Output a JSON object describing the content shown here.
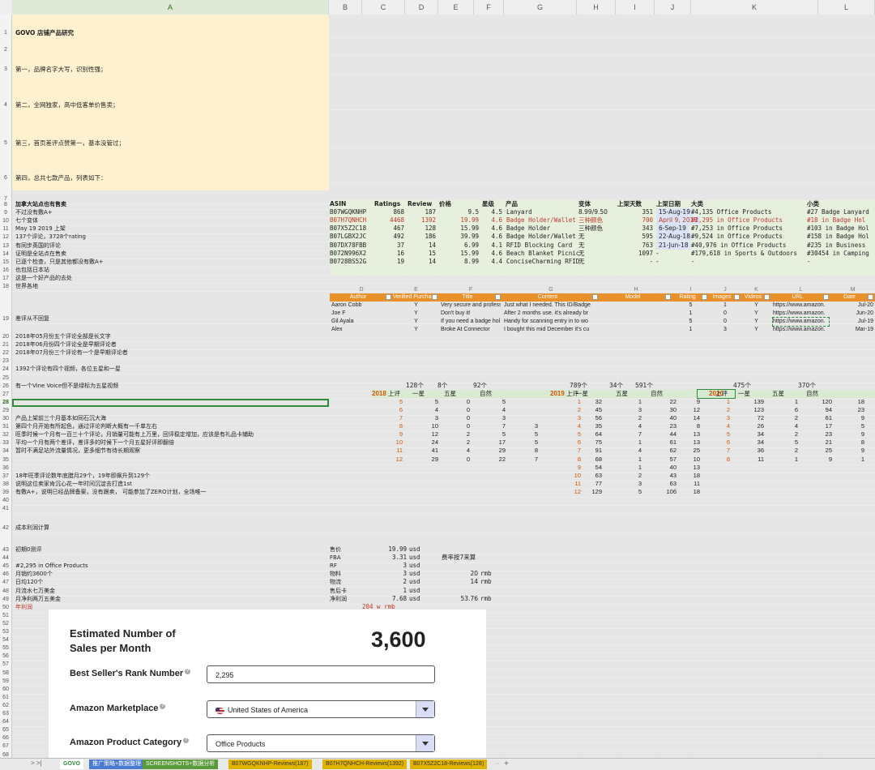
{
  "colors": {
    "note_bg": "#fdf1cf",
    "table_bg": "#e6f0dd",
    "filter_header": "#e8902a",
    "green_sel": "#2e8b3a",
    "red_text": "#c0392b",
    "orange_text": "#d35400",
    "year_bg": "#d9ead3"
  },
  "column_headers": [
    "A",
    "B",
    "C",
    "D",
    "E",
    "F",
    "G",
    "H",
    "I",
    "J",
    "K",
    "L"
  ],
  "notes": {
    "r1": "GOVO 店铺产品研究",
    "r3": "第一，品牌名字大写，识别性强；",
    "r4": "第二，全网独家，高中低客单价售卖；",
    "r5": "第三，首页差评点赞第一，基本没管过；",
    "r6": "第四，总共七款产品，列表如下："
  },
  "left_notes": [
    {
      "row": "8",
      "text": "加拿大站点也有售卖",
      "bold": true
    },
    {
      "row": "9",
      "text": "不过没有敷A+"
    },
    {
      "row": "10",
      "text": "七个变体"
    },
    {
      "row": "11",
      "text": "May 19 2019 上架"
    },
    {
      "row": "12",
      "text": "137个评论，3728个rating"
    },
    {
      "row": "13",
      "text": "有同步英国的评论"
    },
    {
      "row": "14",
      "text": "证明是全站点在售卖"
    },
    {
      "row": "15",
      "text": "已逐个检查，只是其他都没有敷A+"
    },
    {
      "row": "16",
      "text": "也包括日本站"
    },
    {
      "row": "17",
      "text": "这是一个好产品的去处"
    },
    {
      "row": "18",
      "text": "世界各地"
    },
    {
      "row": "19",
      "text": "差评从不回复"
    },
    {
      "row": "20",
      "text": "2018年05月份五个评论全部是长文字"
    },
    {
      "row": "21",
      "text": "2018年06月份四个评论全是早期评论者"
    },
    {
      "row": "22",
      "text": "2018年07月份三个评论有一个是早期评论者"
    },
    {
      "row": "24",
      "text": "1392个评论有四个视频，各位五星和一星"
    },
    {
      "row": "26",
      "text": "有一个Vine Voice但不是绿标为五星视频"
    },
    {
      "row": "30",
      "text": "产品上架前三个月基本如同石沉大海"
    },
    {
      "row": "31",
      "text": "第四个月开始有所起色，通过评论判断大概有一千单左右"
    },
    {
      "row": "32",
      "text": "旺季时候一个月有一百三十个评论，月销量可能有上万里，回评稳定增加，应该是有礼品卡辅助"
    },
    {
      "row": "33",
      "text": "平均一个月有两个差评，差评多的时候下一个月五星好评即翻倍"
    },
    {
      "row": "34",
      "text": "暂时不满足站外流量情况，更多细节有待长期观察"
    },
    {
      "row": "37",
      "text": "18年旺季评论数年底腊月29个，19年即飙升到129个"
    },
    {
      "row": "38",
      "text": "说明这位卖家肯沉心花一年时间沉淀去打造1st"
    },
    {
      "row": "39",
      "text": "有敷A+，说明已经品牌备案，没有跟卖， 可能参加了ZERO计划，全场唯一"
    },
    {
      "row": "42",
      "text": "成本利润计算"
    },
    {
      "row": "43",
      "text": "初期0测评"
    },
    {
      "row": "45",
      "text": "#2,295 in  Office Products"
    },
    {
      "row": "46",
      "text": "月销约3600个"
    },
    {
      "row": "47",
      "text": "日均120个"
    },
    {
      "row": "48",
      "text": "月流水七万美金"
    },
    {
      "row": "49",
      "text": "月净利两万五美金"
    },
    {
      "row": "50",
      "text": "年利润",
      "red": true
    }
  ],
  "product_table": {
    "headers": [
      "ASIN",
      "Ratings",
      "Review",
      "价格",
      "星级",
      "产品",
      "变体",
      "上架天数",
      "上架日期",
      "大类",
      "小类"
    ],
    "rows": [
      [
        "B07WGQKNHP",
        "868",
        "187",
        "9.5",
        "4.5",
        "Lanyard",
        "8.99/9.50",
        "351",
        "15-Aug-19",
        "#4,135 Office Products",
        "#27 Badge Lanyard"
      ],
      [
        "B07H7QNHCH",
        "4468",
        "1392",
        "19.99",
        "4.6",
        "Badge Holder/Wallet",
        "三种颜色",
        "700",
        "April 9, 2018",
        "#2,295 in  Office Products",
        "#18 in  Badge Hol"
      ],
      [
        "B07X5Z2C18",
        "467",
        "128",
        "15.99",
        "4.6",
        "Badge Holder",
        "三种颜色",
        "343",
        "6-Sep-19",
        "#7,253 in Office Products",
        "#103 in Badge Hol"
      ],
      [
        "B07LGBX2JC",
        "492",
        "186",
        "39.99",
        "4.6",
        "Badge Holder/Wallet",
        "无",
        "595",
        "22-Aug-18",
        "#9,524 in Office Products",
        "#158 in Badge Hol"
      ],
      [
        "B07DX78FBB",
        "37",
        "14",
        "6.99",
        "4.1",
        "RFID Blocking Card",
        "无",
        "763",
        "21-Jun-18",
        "#40,976 in Office Products",
        "#235 in Business"
      ],
      [
        "B072N996X2",
        "16",
        "15",
        "15.99",
        "4.6",
        "Beach Blanket Picnic",
        "无",
        "1097",
        "-",
        "#179,618 in Sports & Outdoors",
        "#30454 in Camping"
      ],
      [
        "B0728BS52G",
        "19",
        "14",
        "8.99",
        "4.4",
        "ConciseCharming RFID",
        "无",
        "-",
        "-",
        "-",
        "-"
      ]
    ]
  },
  "review_table": {
    "col_letters": [
      "D",
      "E",
      "F",
      "G",
      "H",
      "I",
      "J",
      "K",
      "L",
      "M"
    ],
    "headers": [
      "Author",
      "Verified Purchase",
      "Title",
      "Content",
      "Model",
      "Rating",
      "Images",
      "Videos",
      "URL",
      "Date"
    ],
    "rows": [
      [
        "Aaron Cobb",
        "Y",
        "Very secure and profess",
        "Just what I needed. This ID/Badge",
        "",
        "5",
        "1",
        "Y",
        "https://www.amazon.",
        "Jul-20"
      ],
      [
        "Joe F",
        "Y",
        "Don't buy it!",
        "After 2 months use. it's already br",
        "",
        "1",
        "0",
        "Y",
        "https://www.amazon.",
        "Jun-20"
      ],
      [
        "Gil Ayala",
        "Y",
        "If you need a badge hol",
        "Handy for scanning entry in to wo",
        "",
        "5",
        "0",
        "Y",
        "https://www.amazon.",
        "Jul-19"
      ],
      [
        "Alex",
        "Y",
        "Broke At Connector",
        "I bought this mid December it's cu",
        "",
        "1",
        "3",
        "Y",
        "https://www.amazon.",
        "Mar-19"
      ]
    ]
  },
  "yearly_stats": {
    "y2018": {
      "label": "2018",
      "totals": [
        "128个",
        "8个",
        "92个"
      ],
      "headers": [
        "上评",
        "一星",
        "五星",
        "自然"
      ],
      "rows": [
        [
          "5",
          "5",
          "0",
          "5",
          ""
        ],
        [
          "6",
          "4",
          "0",
          "4",
          ""
        ],
        [
          "7",
          "3",
          "0",
          "3",
          ""
        ],
        [
          "8",
          "10",
          "0",
          "7",
          "3"
        ],
        [
          "9",
          "12",
          "2",
          "5",
          "5"
        ],
        [
          "10",
          "24",
          "2",
          "17",
          "5"
        ],
        [
          "11",
          "41",
          "4",
          "29",
          "8"
        ],
        [
          "12",
          "29",
          "0",
          "22",
          "7"
        ]
      ]
    },
    "y2019": {
      "label": "2019",
      "totals": [
        "789个",
        "34个",
        "591个"
      ],
      "headers": [
        "上评",
        "一星",
        "五星",
        "自然"
      ],
      "rows": [
        [
          "1",
          "32",
          "1",
          "22",
          "9"
        ],
        [
          "2",
          "45",
          "3",
          "30",
          "12"
        ],
        [
          "3",
          "56",
          "2",
          "40",
          "14"
        ],
        [
          "4",
          "35",
          "4",
          "23",
          "8"
        ],
        [
          "5",
          "64",
          "7",
          "44",
          "13"
        ],
        [
          "6",
          "75",
          "1",
          "61",
          "13"
        ],
        [
          "7",
          "91",
          "4",
          "62",
          "25"
        ],
        [
          "8",
          "68",
          "1",
          "57",
          "10"
        ],
        [
          "9",
          "54",
          "1",
          "40",
          "13"
        ],
        [
          "10",
          "63",
          "2",
          "43",
          "18"
        ],
        [
          "11",
          "77",
          "3",
          "63",
          "11"
        ],
        [
          "12",
          "129",
          "5",
          "106",
          "18"
        ]
      ]
    },
    "y2020": {
      "label": "2020",
      "totals": [
        "475个",
        "370个"
      ],
      "headers": [
        "上评",
        "一星",
        "五星",
        "自然"
      ],
      "rows": [
        [
          "1",
          "139",
          "1",
          "120",
          "18"
        ],
        [
          "2",
          "123",
          "6",
          "94",
          "23"
        ],
        [
          "3",
          "72",
          "2",
          "61",
          "9"
        ],
        [
          "4",
          "26",
          "4",
          "17",
          "5"
        ],
        [
          "5",
          "34",
          "2",
          "23",
          "9"
        ],
        [
          "6",
          "34",
          "5",
          "21",
          "8"
        ],
        [
          "7",
          "36",
          "2",
          "25",
          "9"
        ],
        [
          "8",
          "11",
          "1",
          "9",
          "1"
        ]
      ]
    }
  },
  "cost": {
    "rows": [
      {
        "label": "售价",
        "value": "19.99",
        "unit": "usd",
        "extra": "",
        "extra_unit": ""
      },
      {
        "label": "FBA",
        "value": "3.31",
        "unit": "usd",
        "extra": "费率按7来算",
        "extra_unit": ""
      },
      {
        "label": "RF",
        "value": "3",
        "unit": "usd",
        "extra": "",
        "extra_unit": ""
      },
      {
        "label": "物料",
        "value": "3",
        "unit": "usd",
        "extra": "20",
        "extra_unit": "rmb"
      },
      {
        "label": "物流",
        "value": "2",
        "unit": "usd",
        "extra": "14",
        "extra_unit": "rmb"
      },
      {
        "label": "售后卡",
        "value": "1",
        "unit": "usd",
        "extra": "",
        "extra_unit": ""
      },
      {
        "label": "净利润",
        "value": "7.68",
        "unit": "usd",
        "extra": "53.76",
        "extra_unit": "rmb"
      }
    ],
    "annual": "204 w rmb"
  },
  "calculator": {
    "title_line1": "Estimated Number of",
    "title_line2": "Sales per Month",
    "result": "3,600",
    "bsr_label": "Best Seller's Rank Number",
    "bsr_value": "2,295",
    "marketplace_label": "Amazon Marketplace",
    "marketplace_value": "United States of America",
    "category_label": "Amazon Product Category",
    "category_value": "Office Products"
  },
  "tabs": [
    "GOVO",
    "推广策略+数据整理",
    "SCREENSHOTS+数据分析",
    "B07WGQKNHP-Reviews(187)",
    "B07H7QNHCH-Reviews(1392)",
    "B07X5Z2C18-Reviews(128)"
  ],
  "tab_colors": [
    "#ffffff",
    "#4a7bd0",
    "#5b9a3a",
    "#e0b400",
    "#e0b400",
    "#e0b400"
  ]
}
